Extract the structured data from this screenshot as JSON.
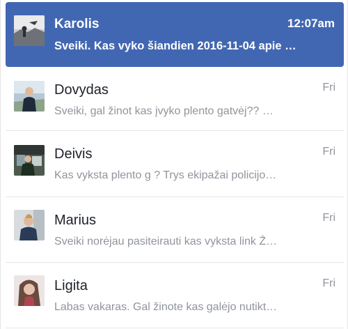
{
  "conversations": [
    {
      "name": "Karolis",
      "time": "12:07am",
      "snippet": "Sveiki. Kas vyko šiandien 2016-11-04 apie …",
      "active": true,
      "avatar": "avatar-karolis"
    },
    {
      "name": "Dovydas",
      "time": "Fri",
      "snippet": "Sveiki, gal žinot kas įvyko plento gatvėj?? …",
      "active": false,
      "avatar": "avatar-dovydas"
    },
    {
      "name": "Deivis",
      "time": "Fri",
      "snippet": "Kas vyksta plento g ? Trys ekipažai policijo…",
      "active": false,
      "avatar": "avatar-deivis"
    },
    {
      "name": "Marius",
      "time": "Fri",
      "snippet": "Sveiki norėjau pasiteirauti kas vyksta link Ž…",
      "active": false,
      "avatar": "avatar-marius"
    },
    {
      "name": "Ligita",
      "time": "Fri",
      "snippet": "Labas vakaras. Gal žinote kas galėjo nutikt…",
      "active": false,
      "avatar": "avatar-ligita"
    }
  ],
  "colors": {
    "active_background": "#4267b2",
    "active_text": "#ffffff",
    "name_text": "#1d2129",
    "muted_text": "#90949c",
    "divider": "#e5e5e5"
  }
}
